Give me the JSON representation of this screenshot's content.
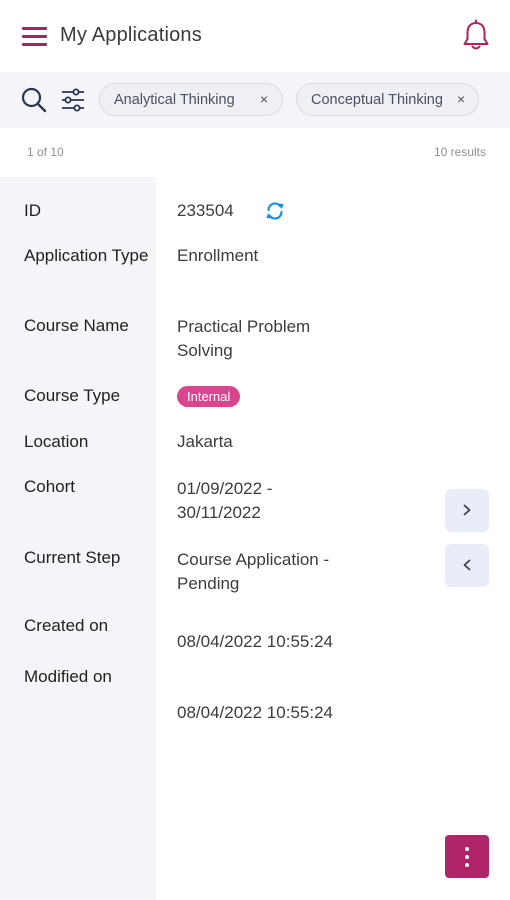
{
  "header": {
    "title": "My Applications",
    "menu_icon": "hamburger-menu-icon",
    "bell_icon": "bell-icon",
    "accent_color": "#b0225f"
  },
  "filters": {
    "search_icon": "search-icon",
    "filter_icon": "sliders-icon",
    "chips": [
      {
        "label": "Analytical Thinking",
        "remove": "×"
      },
      {
        "label": "Conceptual Thinking",
        "remove": "×"
      }
    ]
  },
  "pagination": {
    "position": "1 of 10",
    "results": "10 results"
  },
  "record": {
    "id_label": "ID",
    "id_value": "233504",
    "app_type_label": "Application Type",
    "app_type_value": "Enrollment",
    "course_name_label": "Course Name",
    "course_name_value": "Practical Problem Solving",
    "course_type_label": "Course Type",
    "course_type_value": "Internal",
    "course_type_color": "#d9468f",
    "location_label": "Location",
    "location_value": "Jakarta",
    "cohort_label": "Cohort",
    "cohort_value": "01/09/2022 - 30/11/2022",
    "current_step_label": "Current Step",
    "current_step_value": "Course Application - Pending",
    "created_label": "Created on",
    "created_value": "08/04/2022 10:55:24",
    "modified_label": "Modified on",
    "modified_value": "08/04/2022 10:55:24"
  },
  "actions": {
    "next_icon": "chevron-right-icon",
    "prev_icon": "chevron-left-icon",
    "more_icon": "more-vertical-icon",
    "fab_color": "#b0256a"
  }
}
